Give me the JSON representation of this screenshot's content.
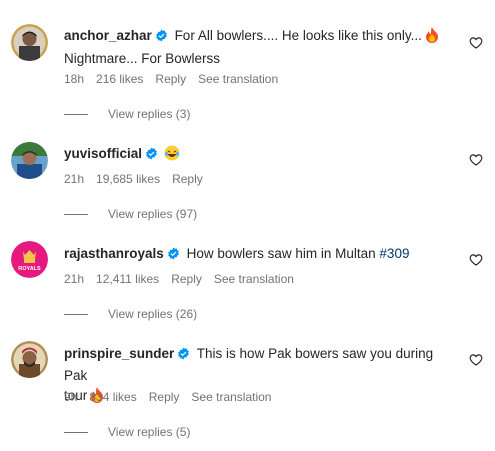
{
  "comments": [
    {
      "username": "anchor_azhar",
      "text_line1": "For All bowlers.... He looks like this only...",
      "text_line2": "Nightmare... For Bowlerss",
      "time": "18h",
      "likes": "216 likes",
      "reply_label": "Reply",
      "translate_label": "See translation",
      "view_replies": "View replies (3)",
      "emoji": "fire-emoji"
    },
    {
      "username": "yuvisofficial",
      "text_line1": "",
      "time": "21h",
      "likes": "19,685 likes",
      "reply_label": "Reply",
      "view_replies": "View replies (97)",
      "emoji": "laughing-emoji"
    },
    {
      "username": "rajasthanroyals",
      "text_line1": "How bowlers saw him in Multan",
      "hashtag": "#309",
      "time": "21h",
      "likes": "12,411 likes",
      "reply_label": "Reply",
      "translate_label": "See translation",
      "view_replies": "View replies (26)",
      "avatar_text": "ROYALS"
    },
    {
      "username": "prinspire_sunder",
      "text_line1": "This is how Pak bowers saw you during Pak",
      "text_line2": "tour",
      "time": "9h",
      "likes": "834 likes",
      "reply_label": "Reply",
      "translate_label": "See translation",
      "view_replies": "View replies (5)",
      "emoji": "fire-emoji"
    }
  ],
  "colors": {
    "text": "#262626",
    "secondary": "#737373",
    "verified": "#0095f6",
    "hashtag": "#00376b",
    "royals_pink": "#e6197e"
  }
}
